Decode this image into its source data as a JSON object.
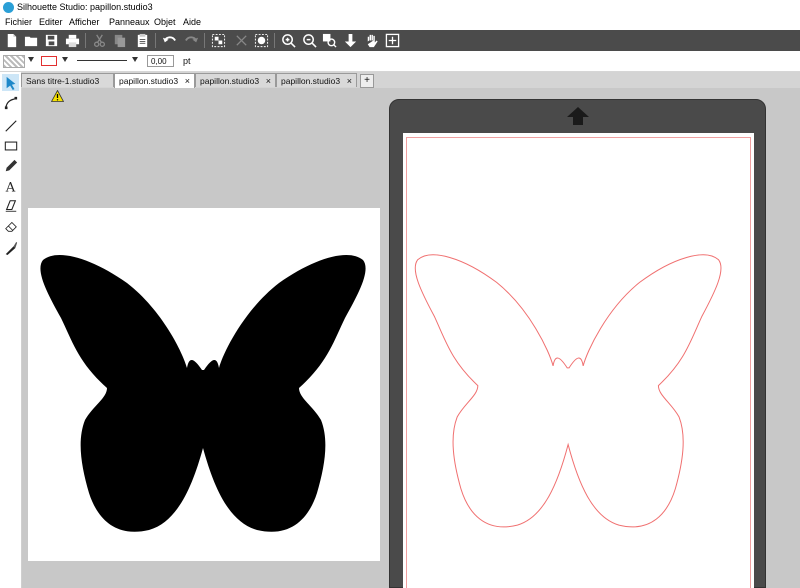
{
  "window": {
    "title": "Silhouette Studio: papillon.studio3"
  },
  "menu": [
    "Fichier",
    "Editer",
    "Afficher",
    "Panneaux",
    "Objet",
    "Aide"
  ],
  "toolbar": {
    "icons": [
      "new-file-icon",
      "open-folder-icon",
      "save-icon",
      "print-icon",
      "cut-icon",
      "copy-icon",
      "paste-icon",
      "undo-icon",
      "redo-icon",
      "group-icon",
      "ungroup-icon",
      "compound-path-icon",
      "zoom-in-icon",
      "zoom-out-icon",
      "zoom-fit-icon",
      "move-down-icon",
      "pan-hand-icon",
      "fit-page-icon"
    ]
  },
  "properties": {
    "line_width": "0,00",
    "line_unit": "pt",
    "line_color": "#e23030"
  },
  "tabs": [
    {
      "label": "Sans titre-1.studio3",
      "active": false
    },
    {
      "label": "papillon.studio3",
      "active": true
    },
    {
      "label": "papillon.studio3",
      "active": false
    },
    {
      "label": "papillon.studio3",
      "active": false
    }
  ],
  "tab_close": "×",
  "tab_add": "+",
  "colors": {
    "toolbar": "#4b4b4b",
    "mat": "#4a4a4a",
    "cut_line": "#f07070",
    "shape_fill": "#000000",
    "warning": "#f5e000"
  }
}
